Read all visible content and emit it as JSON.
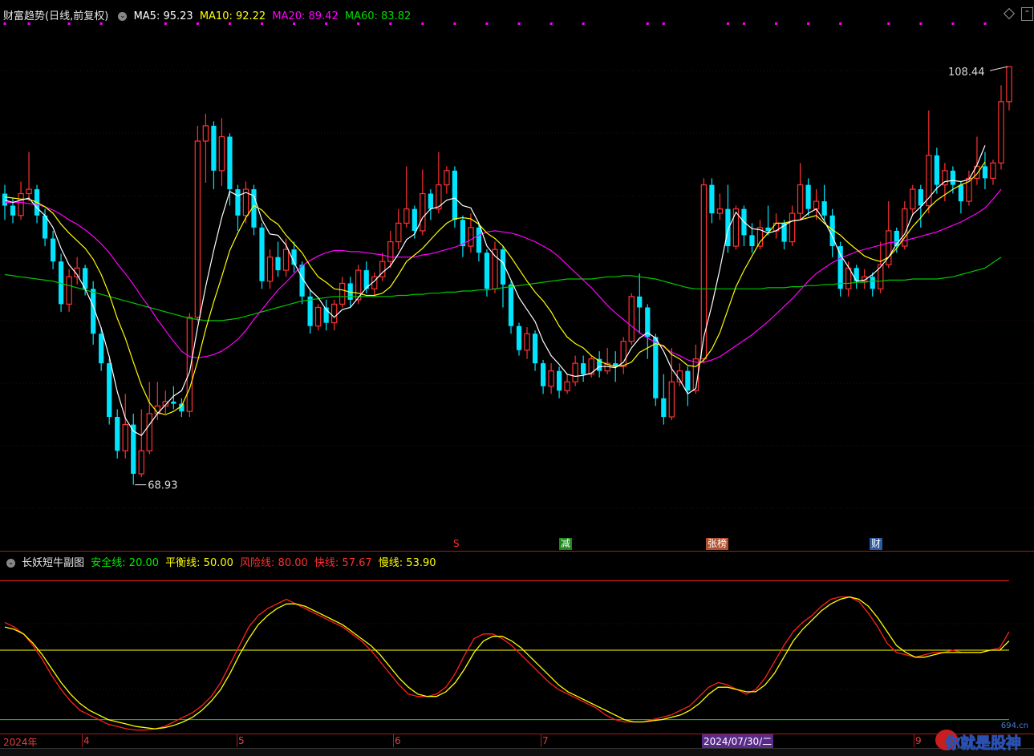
{
  "main_header": {
    "title": "财富趋势(日线,前复权)",
    "ma5": "MA5: 95.23",
    "ma10": "MA10: 92.22",
    "ma20": "MA20: 89.42",
    "ma60": "MA60: 83.82"
  },
  "main_annotations": {
    "max_label": "108.44",
    "min_label": "68.93"
  },
  "event_tags": [
    {
      "label": "S",
      "color": "#ff3030"
    },
    {
      "label": "减",
      "color": "#30c030"
    },
    {
      "label": "张榜",
      "color": "#ff8040"
    },
    {
      "label": "财",
      "color": "#4080ff"
    }
  ],
  "sub_header": {
    "title": "长妖短牛副图",
    "safe": "安全线: 20.00",
    "balance": "平衡线: 50.00",
    "risk": "风险线: 80.00",
    "fast": "快线: 57.67",
    "slow": "慢线: 53.90"
  },
  "time_axis": {
    "labels": [
      "2024年",
      "4",
      "5",
      "6",
      "7",
      "9"
    ],
    "cursor_date": "2024/07/30/二"
  },
  "watermark": {
    "text": "你就是股神",
    "url": "694.cn"
  },
  "colors": {
    "up": "#ff3232",
    "down": "#00e5ff",
    "ma5": "#ffffff",
    "ma10": "#ffff00",
    "ma20": "#ff00ff",
    "ma60": "#00c800"
  },
  "chart_data": {
    "type": "candlestick",
    "ylim": [
      66,
      112
    ],
    "candles": [
      [
        96.8,
        95.7,
        97.6,
        94.4
      ],
      [
        95.7,
        94.8,
        96.4,
        94.1
      ],
      [
        94.8,
        96.8,
        97.9,
        94.4
      ],
      [
        96.8,
        97.2,
        100.6,
        96.1
      ],
      [
        97.2,
        94.8,
        97.6,
        94.1
      ],
      [
        94.8,
        92.7,
        95.4,
        92.0
      ],
      [
        92.7,
        90.6,
        93.4,
        89.9
      ],
      [
        90.6,
        86.7,
        91.3,
        86.0
      ],
      [
        86.7,
        89.2,
        89.9,
        86.0
      ],
      [
        89.2,
        90.0,
        91.0,
        88.5
      ],
      [
        90.0,
        88.1,
        90.3,
        87.5
      ],
      [
        88.1,
        84.0,
        88.8,
        83.0
      ],
      [
        84.0,
        81.3,
        84.6,
        80.6
      ],
      [
        81.3,
        76.4,
        81.7,
        75.7
      ],
      [
        76.4,
        73.3,
        77.1,
        72.6
      ],
      [
        73.3,
        75.7,
        78.5,
        72.6
      ],
      [
        75.7,
        71.2,
        76.7,
        70.2
      ],
      [
        71.2,
        73.3,
        77.1,
        70.9
      ],
      [
        73.3,
        76.7,
        79.6,
        73.0
      ],
      [
        76.7,
        77.4,
        79.6,
        76.1
      ],
      [
        77.4,
        77.8,
        78.8,
        76.7
      ],
      [
        77.8,
        77.6,
        79.2,
        77.1
      ],
      [
        77.6,
        76.9,
        78.1,
        76.4
      ],
      [
        76.9,
        85.5,
        85.9,
        76.4
      ],
      [
        85.5,
        101.6,
        103.0,
        85.1
      ],
      [
        101.6,
        103.0,
        104.1,
        97.8
      ],
      [
        103.0,
        98.9,
        103.4,
        97.2
      ],
      [
        98.9,
        102.0,
        103.7,
        97.5
      ],
      [
        102.0,
        97.2,
        102.3,
        95.7
      ],
      [
        97.2,
        94.8,
        97.6,
        93.4
      ],
      [
        94.8,
        97.2,
        97.9,
        94.1
      ],
      [
        97.2,
        93.7,
        97.6,
        93.0
      ],
      [
        93.7,
        88.8,
        94.1,
        88.1
      ],
      [
        88.8,
        91.0,
        91.7,
        88.1
      ],
      [
        91.0,
        89.8,
        92.4,
        89.2
      ],
      [
        89.8,
        91.7,
        92.7,
        89.2
      ],
      [
        91.7,
        90.3,
        92.4,
        89.6
      ],
      [
        90.3,
        87.4,
        90.6,
        86.7
      ],
      [
        87.4,
        84.7,
        88.1,
        84.0
      ],
      [
        84.7,
        86.4,
        86.7,
        84.3
      ],
      [
        86.4,
        85.0,
        87.1,
        84.3
      ],
      [
        85.0,
        86.7,
        87.1,
        84.3
      ],
      [
        86.7,
        88.6,
        89.2,
        86.4
      ],
      [
        88.6,
        87.1,
        89.2,
        86.4
      ],
      [
        87.1,
        89.8,
        90.3,
        86.7
      ],
      [
        89.8,
        88.1,
        90.6,
        87.7
      ],
      [
        88.1,
        89.2,
        89.6,
        87.4
      ],
      [
        89.2,
        90.6,
        91.4,
        88.8
      ],
      [
        90.6,
        92.4,
        93.4,
        90.0
      ],
      [
        92.4,
        94.1,
        95.4,
        91.7
      ],
      [
        94.1,
        95.4,
        99.3,
        93.7
      ],
      [
        95.4,
        93.4,
        95.7,
        92.7
      ],
      [
        93.4,
        96.8,
        99.0,
        93.0
      ],
      [
        96.8,
        95.4,
        97.2,
        94.4
      ],
      [
        95.4,
        97.6,
        100.6,
        95.0
      ],
      [
        97.6,
        98.9,
        99.3,
        96.8
      ],
      [
        98.9,
        94.4,
        99.3,
        93.7
      ],
      [
        94.4,
        92.0,
        94.8,
        91.0
      ],
      [
        92.0,
        93.7,
        95.0,
        91.4
      ],
      [
        93.7,
        91.4,
        94.1,
        90.6
      ],
      [
        91.4,
        88.1,
        91.7,
        87.4
      ],
      [
        88.1,
        91.7,
        92.4,
        87.7
      ],
      [
        91.7,
        88.5,
        92.0,
        86.4
      ],
      [
        88.5,
        84.7,
        88.8,
        84.0
      ],
      [
        84.7,
        82.5,
        85.0,
        82.0
      ],
      [
        82.5,
        84.0,
        84.6,
        81.7
      ],
      [
        84.0,
        81.3,
        84.3,
        80.6
      ],
      [
        81.3,
        79.2,
        81.6,
        78.5
      ],
      [
        79.2,
        80.6,
        81.3,
        78.5
      ],
      [
        80.6,
        78.8,
        81.0,
        78.1
      ],
      [
        78.8,
        79.6,
        80.3,
        78.5
      ],
      [
        79.6,
        81.3,
        82.0,
        79.2
      ],
      [
        81.3,
        80.3,
        82.0,
        79.6
      ],
      [
        80.3,
        81.7,
        82.0,
        80.0
      ],
      [
        81.7,
        80.6,
        82.4,
        80.0
      ],
      [
        80.6,
        81.3,
        82.7,
        80.3
      ],
      [
        81.3,
        81.0,
        82.4,
        79.6
      ],
      [
        81.0,
        83.3,
        83.7,
        80.3
      ],
      [
        83.3,
        87.4,
        87.7,
        83.0
      ],
      [
        87.4,
        86.4,
        89.5,
        84.0
      ],
      [
        86.4,
        83.7,
        86.7,
        81.7
      ],
      [
        83.7,
        78.1,
        84.0,
        77.4
      ],
      [
        78.1,
        76.4,
        80.3,
        75.7
      ],
      [
        76.4,
        79.6,
        82.7,
        76.1
      ],
      [
        79.6,
        80.6,
        81.3,
        79.2
      ],
      [
        80.6,
        78.8,
        81.0,
        77.4
      ],
      [
        78.8,
        81.7,
        83.0,
        78.5
      ],
      [
        81.7,
        97.6,
        98.2,
        81.3
      ],
      [
        97.6,
        95.0,
        98.2,
        94.1
      ],
      [
        95.0,
        95.4,
        96.8,
        94.4
      ],
      [
        95.4,
        92.0,
        97.6,
        91.4
      ],
      [
        92.0,
        95.4,
        95.7,
        91.7
      ],
      [
        95.4,
        93.0,
        95.7,
        92.0
      ],
      [
        93.0,
        92.0,
        94.1,
        91.4
      ],
      [
        92.0,
        93.7,
        94.4,
        91.7
      ],
      [
        93.7,
        93.4,
        95.7,
        93.0
      ],
      [
        93.4,
        94.1,
        95.0,
        92.7
      ],
      [
        94.1,
        92.4,
        94.4,
        91.7
      ],
      [
        92.4,
        95.0,
        95.7,
        92.0
      ],
      [
        95.0,
        97.6,
        99.6,
        94.4
      ],
      [
        97.6,
        95.4,
        98.2,
        94.8
      ],
      [
        95.4,
        96.1,
        97.2,
        94.4
      ],
      [
        96.1,
        94.8,
        97.6,
        94.4
      ],
      [
        94.8,
        92.0,
        95.4,
        91.0
      ],
      [
        92.0,
        88.1,
        92.4,
        87.4
      ],
      [
        88.1,
        90.0,
        90.6,
        87.4
      ],
      [
        90.0,
        88.8,
        90.3,
        88.1
      ],
      [
        88.8,
        89.2,
        89.9,
        88.1
      ],
      [
        89.2,
        88.1,
        89.6,
        87.4
      ],
      [
        88.1,
        90.3,
        92.4,
        87.7
      ],
      [
        90.3,
        93.4,
        96.1,
        90.0
      ],
      [
        93.4,
        92.0,
        93.7,
        91.4
      ],
      [
        92.0,
        95.4,
        96.1,
        91.7
      ],
      [
        95.4,
        97.2,
        97.6,
        94.8
      ],
      [
        97.2,
        95.7,
        97.6,
        93.7
      ],
      [
        95.7,
        100.3,
        104.4,
        95.0
      ],
      [
        100.3,
        97.6,
        101.0,
        96.8
      ],
      [
        97.6,
        98.9,
        99.6,
        96.1
      ],
      [
        98.9,
        97.6,
        99.3,
        96.8
      ],
      [
        97.6,
        96.1,
        97.9,
        95.0
      ],
      [
        96.1,
        98.2,
        98.9,
        95.7
      ],
      [
        98.2,
        99.3,
        102.0,
        97.6
      ],
      [
        99.3,
        98.2,
        100.6,
        97.2
      ],
      [
        98.2,
        99.6,
        99.9,
        97.6
      ],
      [
        99.6,
        105.2,
        106.7,
        99.0
      ],
      [
        105.2,
        108.4,
        108.4,
        104.4
      ]
    ],
    "ma5": [
      96.2,
      96.0,
      96.2,
      96.4,
      95.5,
      94.8,
      93.7,
      91.8,
      90.3,
      89.4,
      88.1,
      86.5,
      84.5,
      81.9,
      78.7,
      76.3,
      75.1,
      74.7,
      75.7,
      76.7,
      77.5,
      78.3,
      78.8,
      80.5,
      84.6,
      88.3,
      91.6,
      94.6,
      97.0,
      96.6,
      96.9,
      96.6,
      94.4,
      93.1,
      93.0,
      92.1,
      90.5,
      89.1,
      88.0,
      87.3,
      86.2,
      85.5,
      86.2,
      86.4,
      87.3,
      88.2,
      88.8,
      89.6,
      90.2,
      91.3,
      92.6,
      93.1,
      94.6,
      95.4,
      95.6,
      96.2,
      96.4,
      95.7,
      95.5,
      94.1,
      92.0,
      91.1,
      90.5,
      88.9,
      87.3,
      86.2,
      85.1,
      83.3,
      82.0,
      81.2,
      80.3,
      80.1,
      80.2,
      80.4,
      81.0,
      81.0,
      80.9,
      81.4,
      82.7,
      83.6,
      84.1,
      83.6,
      82.4,
      80.8,
      79.8,
      78.5,
      79.0,
      83.7,
      86.6,
      89.9,
      93.5,
      95.1,
      94.2,
      93.6,
      93.5,
      93.2,
      93.4,
      93.9,
      94.3,
      94.4,
      95.0,
      95.4,
      94.3,
      92.9,
      91.2,
      90.1,
      88.8,
      88.9,
      89.4,
      90.1,
      91.0,
      92.2,
      93.1,
      94.9,
      95.6,
      96.4,
      97.3,
      97.9,
      98.0,
      97.9,
      98.1,
      99.4,
      101.2
    ],
    "ma10": [
      96.5,
      96.4,
      96.3,
      96.3,
      96.0,
      95.6,
      95.0,
      94.0,
      93.2,
      92.5,
      91.8,
      90.8,
      89.4,
      87.6,
      85.4,
      83.6,
      81.4,
      79.3,
      77.7,
      76.8,
      76.6,
      76.9,
      77.4,
      79.0,
      81.5,
      84.4,
      86.9,
      89.2,
      91.6,
      93.2,
      94.6,
      95.7,
      95.3,
      94.5,
      94.0,
      93.0,
      92.2,
      91.4,
      90.2,
      89.2,
      88.7,
      88.1,
      88.0,
      87.8,
      87.7,
      87.5,
      87.5,
      87.7,
      88.3,
      89.4,
      90.6,
      91.2,
      91.8,
      92.6,
      93.4,
      94.1,
      94.5,
      94.6,
      94.5,
      94.0,
      93.2,
      92.7,
      92.0,
      91.0,
      89.9,
      88.8,
      87.8,
      87.0,
      86.0,
      84.7,
      83.7,
      83.1,
      82.7,
      82.0,
      81.5,
      81.2,
      81.0,
      81.1,
      81.4,
      82.3,
      82.7,
      83.1,
      82.9,
      82.1,
      81.7,
      81.1,
      81.0,
      81.6,
      82.6,
      84.1,
      86.2,
      88.3,
      89.8,
      91.1,
      92.4,
      93.2,
      94.1,
      94.1,
      94.3,
      94.4,
      94.6,
      94.8,
      94.1,
      93.5,
      93.0,
      92.3,
      91.7,
      91.1,
      90.8,
      90.6,
      91.0,
      91.8,
      92.8,
      93.8,
      94.6,
      95.5,
      96.2,
      96.7,
      97.2,
      97.6,
      97.9,
      98.6,
      99.7
    ],
    "ma20": [
      96.0,
      96.0,
      96.0,
      95.9,
      95.8,
      95.6,
      95.3,
      94.9,
      94.4,
      94.0,
      93.5,
      92.9,
      92.2,
      91.4,
      90.4,
      89.5,
      88.5,
      87.4,
      86.4,
      85.3,
      84.3,
      83.3,
      82.4,
      81.9,
      81.8,
      81.9,
      82.1,
      82.4,
      82.9,
      83.5,
      84.3,
      85.3,
      86.2,
      87.1,
      88.0,
      88.7,
      89.5,
      90.2,
      90.7,
      91.1,
      91.4,
      91.6,
      91.6,
      91.5,
      91.5,
      91.4,
      91.3,
      91.2,
      91.0,
      91.0,
      91.0,
      91.0,
      91.2,
      91.3,
      91.5,
      91.7,
      91.9,
      92.2,
      92.6,
      93.0,
      93.3,
      93.4,
      93.3,
      93.2,
      93.0,
      92.7,
      92.4,
      92.0,
      91.6,
      91.0,
      90.3,
      89.6,
      88.9,
      88.2,
      87.4,
      86.6,
      85.9,
      85.3,
      84.7,
      84.1,
      83.6,
      83.2,
      82.8,
      82.3,
      82.0,
      81.6,
      81.4,
      81.4,
      81.6,
      81.9,
      82.4,
      82.9,
      83.4,
      83.9,
      84.5,
      85.1,
      85.8,
      86.5,
      87.2,
      88.0,
      88.8,
      89.5,
      90.0,
      90.5,
      90.9,
      91.2,
      91.5,
      91.7,
      91.9,
      92.1,
      92.3,
      92.4,
      92.5,
      92.7,
      92.9,
      93.1,
      93.3,
      93.6,
      93.9,
      94.2,
      94.6,
      95.0,
      95.5,
      96.3,
      97.2
    ],
    "ma60": [
      89.4,
      89.3,
      89.2,
      89.1,
      89.0,
      88.9,
      88.8,
      88.6,
      88.4,
      88.2,
      88.0,
      87.8,
      87.6,
      87.4,
      87.2,
      87.0,
      86.8,
      86.6,
      86.4,
      86.2,
      86.0,
      85.8,
      85.6,
      85.4,
      85.3,
      85.2,
      85.2,
      85.2,
      85.3,
      85.4,
      85.6,
      85.8,
      86.0,
      86.2,
      86.4,
      86.6,
      86.8,
      87.0,
      87.1,
      87.2,
      87.3,
      87.4,
      87.4,
      87.4,
      87.4,
      87.4,
      87.4,
      87.4,
      87.4,
      87.5,
      87.5,
      87.6,
      87.6,
      87.7,
      87.7,
      87.8,
      87.8,
      87.9,
      87.9,
      88.0,
      88.0,
      88.1,
      88.2,
      88.3,
      88.4,
      88.5,
      88.6,
      88.7,
      88.8,
      88.9,
      89.0,
      89.0,
      89.0,
      89.0,
      89.1,
      89.2,
      89.2,
      89.3,
      89.3,
      89.2,
      89.1,
      89.0,
      88.8,
      88.6,
      88.4,
      88.2,
      88.1,
      88.1,
      88.1,
      88.1,
      88.1,
      88.1,
      88.1,
      88.1,
      88.1,
      88.2,
      88.2,
      88.2,
      88.3,
      88.3,
      88.4,
      88.4,
      88.5,
      88.5,
      88.6,
      88.6,
      88.7,
      88.7,
      88.8,
      88.8,
      88.9,
      88.9,
      88.9,
      89.0,
      89.0,
      89.0,
      89.0,
      89.1,
      89.2,
      89.4,
      89.6,
      89.8,
      90.0,
      90.5,
      91.0
    ],
    "sub_lines": {
      "ylim": [
        15,
        85
      ],
      "safe": 20,
      "balance": 50,
      "risk": 80,
      "fast": [
        62,
        60,
        57,
        52,
        46,
        39,
        33,
        28,
        24,
        22,
        20,
        18,
        17,
        16,
        15.5,
        15.5,
        16,
        17,
        19,
        21,
        23,
        26,
        30,
        36,
        44,
        52,
        60,
        65,
        68,
        70,
        72,
        70,
        68,
        66,
        64,
        62,
        60,
        57,
        54,
        50,
        45,
        40,
        35,
        31,
        30,
        30,
        31,
        34,
        40,
        48,
        55,
        57,
        57,
        55,
        52,
        48,
        44,
        40,
        36,
        33,
        31,
        29,
        27,
        25,
        22,
        20,
        19,
        19,
        19,
        20,
        21,
        22,
        24,
        26,
        30,
        34,
        36,
        35,
        33,
        31,
        33,
        38,
        45,
        52,
        58,
        62,
        65,
        69,
        72,
        73,
        73,
        71,
        66,
        60,
        53,
        49,
        48,
        47,
        48,
        49,
        49,
        50,
        49,
        49,
        49,
        50,
        51,
        58
      ],
      "slow": [
        60,
        59,
        57,
        53,
        48,
        42,
        36,
        31,
        27,
        24,
        22,
        20,
        19,
        18,
        17,
        16.5,
        16,
        16.5,
        17.5,
        19,
        21,
        24,
        28,
        33,
        40,
        48,
        55,
        61,
        65,
        68,
        70,
        70,
        69,
        67,
        65,
        63,
        61,
        58,
        55,
        52,
        48,
        43,
        38,
        34,
        31,
        30,
        30,
        32,
        36,
        42,
        49,
        54,
        56,
        56,
        54,
        51,
        47,
        43,
        39,
        35,
        32,
        30,
        28,
        26,
        24,
        22,
        20,
        19,
        19,
        19.5,
        20,
        21,
        22,
        24,
        27,
        31,
        34,
        34,
        33,
        32,
        32,
        35,
        40,
        47,
        54,
        59,
        63,
        67,
        70,
        72,
        73,
        72,
        69,
        64,
        58,
        52,
        49,
        47,
        47,
        48,
        49,
        49,
        49,
        49,
        49,
        50,
        50,
        54
      ]
    }
  }
}
